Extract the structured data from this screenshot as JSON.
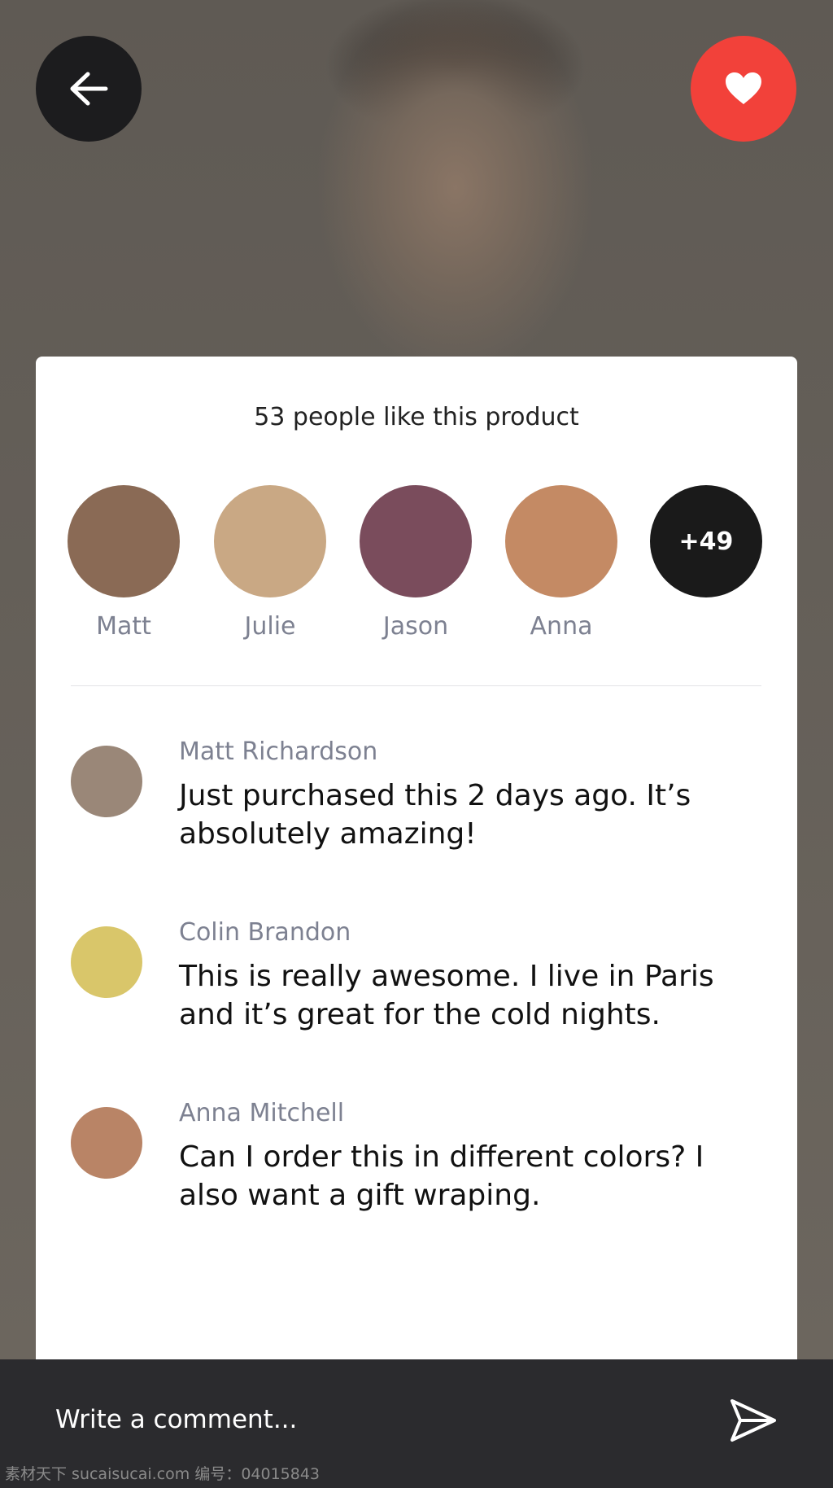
{
  "header": {
    "back_icon": "arrow-left-icon",
    "like_icon": "heart-icon",
    "like_color": "#f2413a"
  },
  "likes": {
    "title": "53 people like this product",
    "people": [
      {
        "name": "Matt",
        "color": "#8a6a55"
      },
      {
        "name": "Julie",
        "color": "#c9a884"
      },
      {
        "name": "Jason",
        "color": "#7a4c5c"
      },
      {
        "name": "Anna",
        "color": "#c48a64"
      }
    ],
    "more_count": "+49"
  },
  "comments": [
    {
      "author": "Matt Richardson",
      "text": "Just purchased this 2 days ago. It’s absolutely amazing!",
      "color": "#9a8778"
    },
    {
      "author": "Colin Brandon",
      "text": "This is really awesome. I live in Paris and it’s great for the cold nights.",
      "color": "#d9c66a"
    },
    {
      "author": "Anna Mitchell",
      "text": "Can I order this in different colors? I also want a gift wraping.",
      "color": "#b98466"
    }
  ],
  "composer": {
    "placeholder": "Write a comment...",
    "send_icon": "send-icon"
  },
  "watermark": "素材天下 sucaisucai.com  编号：04015843"
}
